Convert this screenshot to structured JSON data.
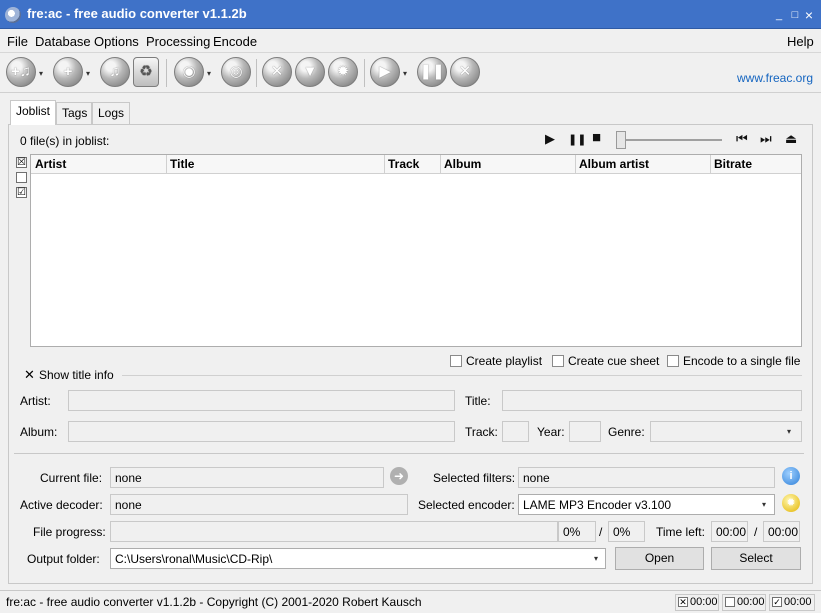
{
  "window": {
    "title": "fre:ac - free audio converter v1.1.2b",
    "min_glyph": "_",
    "max_glyph": "□",
    "close_glyph": "×"
  },
  "menu": {
    "file": "File",
    "database": "Database",
    "options": "Options",
    "processing": "Processing",
    "encode": "Encode",
    "help": "Help"
  },
  "toolbar": {
    "website": "www.freac.org",
    "icons": [
      "add-files-icon",
      "add-folder-icon",
      "audio-cd-icon",
      "clear-joblist-icon",
      "query-cddb-icon",
      "submit-cddb-icon",
      "configure-icon",
      "filter-icon",
      "settings-gear-icon",
      "start-encoding-icon",
      "pause-encoding-icon",
      "stop-encoding-icon"
    ],
    "dropdown_glyph": "▾"
  },
  "tabs": {
    "joblist": "Joblist",
    "tags": "Tags",
    "logs": "Logs"
  },
  "joblist": {
    "count_text": "0 file(s) in joblist:",
    "columns": [
      "Artist",
      "Title",
      "Track",
      "Album",
      "Album artist",
      "Bitrate"
    ],
    "player": {
      "play": "▶",
      "pause": "❚❚",
      "stop": "■",
      "prev": "⏮",
      "next": "⏭",
      "eject": "⏏"
    },
    "check_all": "☒",
    "check_none": "",
    "check_toggle": "☑"
  },
  "options": {
    "create_playlist": "Create playlist",
    "create_cue_sheet": "Create cue sheet",
    "encode_single": "Encode to a single file"
  },
  "title_info": {
    "show_label": "Show title info",
    "show_checked": "✕",
    "artist_label": "Artist:",
    "title_label": "Title:",
    "album_label": "Album:",
    "track_label": "Track:",
    "year_label": "Year:",
    "genre_label": "Genre:"
  },
  "progress": {
    "current_file_label": "Current file:",
    "current_file_value": "none",
    "selected_filters_label": "Selected filters:",
    "selected_filters_value": "none",
    "active_decoder_label": "Active decoder:",
    "active_decoder_value": "none",
    "selected_encoder_label": "Selected encoder:",
    "selected_encoder_value": "LAME MP3 Encoder v3.100",
    "file_progress_label": "File progress:",
    "file_percent": "0%",
    "slash": "/",
    "total_percent": "0%",
    "time_left_label": "Time left:",
    "time_left_value": "00:00",
    "total_time_value": "00:00",
    "output_folder_label": "Output folder:",
    "output_folder_value": "C:\\Users\\ronal\\Music\\CD-Rip\\",
    "open_button": "Open",
    "select_button": "Select"
  },
  "statusbar": {
    "text": "fre:ac - free audio converter v1.1.2b - Copyright (C) 2001-2020 Robert Kausch",
    "cell1_glyph": "✕",
    "cell1_time": "00:00",
    "cell2_glyph": "",
    "cell2_time": "00:00",
    "cell3_glyph": "✓",
    "cell3_time": "00:00"
  }
}
